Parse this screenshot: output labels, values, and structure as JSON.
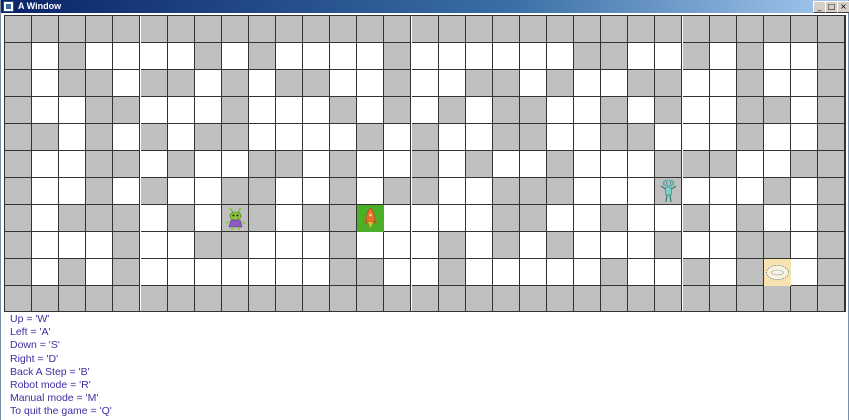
{
  "window": {
    "title": "A Window",
    "controls": {
      "minimize": "_",
      "maximize": "□",
      "close": "×"
    }
  },
  "grid": {
    "rows": 11,
    "cols": 31,
    "cells": [
      "1111111111111111111111111111111",
      "1010000101000010000001100101001",
      "1011011010110010011010011001001",
      "1001100010001010101100101001101",
      "1101010110000101001100110001001",
      "1001101001101001010010001110011",
      "1001010011001011001110001000101",
      "1011101011011000001100100101001",
      "1000100110001000101010001001101",
      "1010100000001100100000100101001",
      "1111111111111111111111111111111"
    ]
  },
  "sprites": [
    {
      "name": "alien-robot-icon",
      "kind": "alien",
      "row": 7,
      "col": 8
    },
    {
      "name": "rocket-icon",
      "kind": "rocket",
      "row": 7,
      "col": 13
    },
    {
      "name": "teal-robot-icon",
      "kind": "teal-robot",
      "row": 6,
      "col": 24
    },
    {
      "name": "goal-portal-icon",
      "kind": "portal",
      "row": 9,
      "col": 28
    }
  ],
  "legend": [
    "Up = 'W'",
    "Left = 'A'",
    "Down = 'S'",
    "Right = 'D'",
    "Back A Step = 'B'",
    "Robot mode = 'R'",
    "Manual mode = 'M'",
    "To quit the game = 'Q'"
  ],
  "colors": {
    "wall": "#c0c0c0",
    "floor": "#ffffff",
    "legend_text": "#3b2fa0",
    "rocket_tile": "#4caf2a",
    "portal_tile": "#f8e3b0"
  }
}
